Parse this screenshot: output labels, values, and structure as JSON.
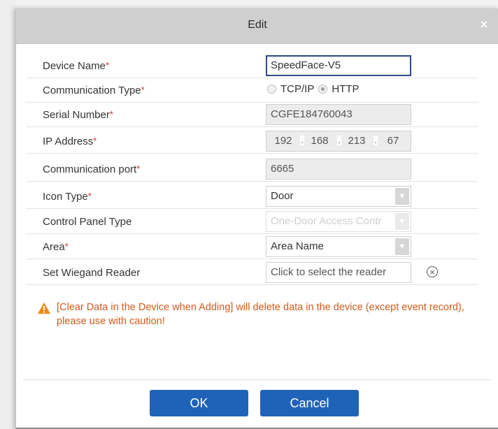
{
  "dialog": {
    "title": "Edit",
    "close_glyph": "×"
  },
  "form": {
    "required_mark": "*",
    "device_name": {
      "label": "Device Name",
      "value": "SpeedFace-V5"
    },
    "communication_type": {
      "label": "Communication Type",
      "options": [
        "TCP/IP",
        "HTTP"
      ],
      "selected": "HTTP"
    },
    "serial_number": {
      "label": "Serial Number",
      "value": "CGFE184760043"
    },
    "ip_address": {
      "label": "IP Address",
      "octets": [
        "192",
        "168",
        "213",
        "67"
      ],
      "separator": "."
    },
    "communication_port": {
      "label": "Communication port",
      "value": "6665"
    },
    "icon_type": {
      "label": "Icon Type",
      "value": "Door"
    },
    "control_panel_type": {
      "label": "Control Panel Type",
      "value": "One-Door Access Contr"
    },
    "area": {
      "label": "Area",
      "value": "Area Name"
    },
    "wiegand_reader": {
      "label": "Set Wiegand Reader",
      "placeholder": "Click to select the reader"
    }
  },
  "warning": {
    "text": "[Clear Data in the Device when Adding] will delete data in the device (except event record), please use with caution!",
    "icon": "warning-triangle-icon",
    "color": "#d35a1a"
  },
  "buttons": {
    "ok": "OK",
    "cancel": "Cancel",
    "color": "#1f63b8"
  }
}
